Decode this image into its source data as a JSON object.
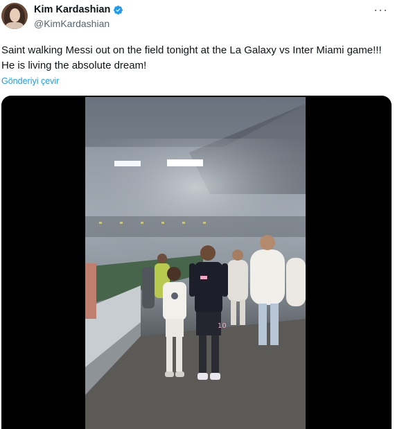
{
  "author": {
    "name": "Kim Kardashian",
    "handle": "@KimKardashian",
    "verified": true,
    "avatar_icon": "profile-avatar"
  },
  "more_label": "···",
  "tweet": {
    "text": "Saint walking Messi out on the field  tonight at the La Galaxy vs Inter Miami game!!! He is living the absolute dream!",
    "translate_label": "Gönderiyi çevir"
  },
  "media": {
    "type": "video",
    "player_number": "10"
  },
  "colors": {
    "accent": "#1d9bf0",
    "text": "#0f1419",
    "secondary": "#536471"
  }
}
